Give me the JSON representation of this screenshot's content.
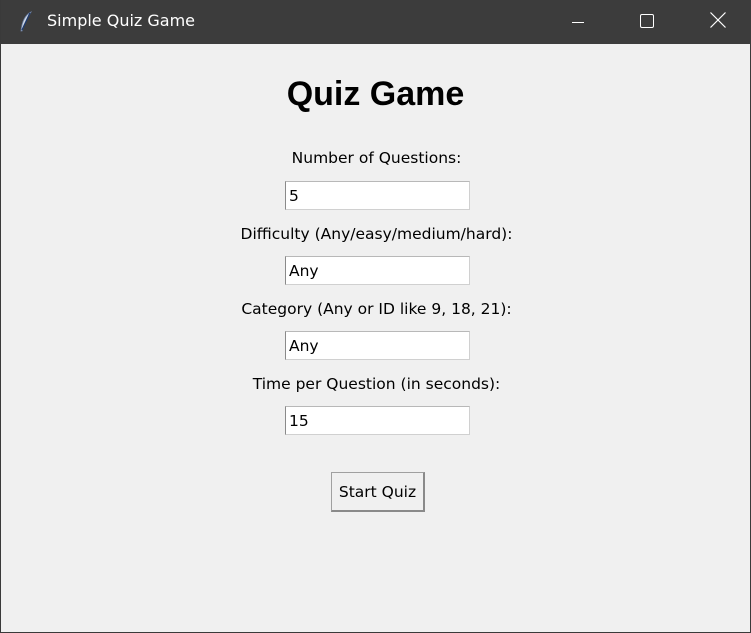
{
  "window": {
    "title": "Simple Quiz Game",
    "app_icon": "feather-icon",
    "controls": {
      "minimize_icon": "minimize-icon",
      "maximize_icon": "maximize-icon",
      "close_icon": "close-icon"
    },
    "titlebar_color": "#3c3c3c",
    "background_color": "#f0f0f0"
  },
  "main": {
    "heading": "Quiz Game",
    "fields": [
      {
        "label": "Number of Questions:",
        "value": "5"
      },
      {
        "label": "Difficulty (Any/easy/medium/hard):",
        "value": "Any"
      },
      {
        "label": "Category (Any or ID like 9, 18, 21):",
        "value": "Any"
      },
      {
        "label": "Time per Question (in seconds):",
        "value": "15"
      }
    ],
    "start_button_label": "Start Quiz"
  }
}
